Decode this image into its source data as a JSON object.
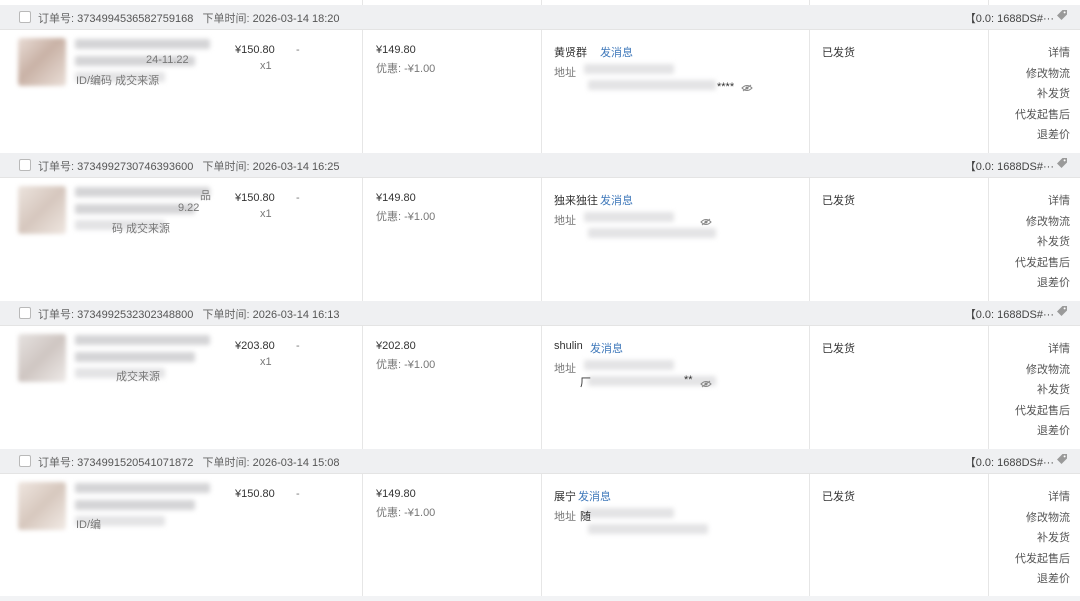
{
  "labels": {
    "order_no": "订单号:",
    "order_time": "下单时间:",
    "send_msg": "发消息",
    "address": "地址",
    "discount": "优惠: -¥1.00",
    "qty": "x1",
    "dash": "-",
    "id_code": "ID/编码",
    "source": "成交来源",
    "source_partial": "码 成交来源"
  },
  "actions": [
    "详情",
    "修改物流",
    "补发货",
    "代发起售后",
    "退差价"
  ],
  "orders": [
    {
      "order_no": "3734994536582759168",
      "order_time": "2026-03-14 18:20",
      "tag": "【0.0: 1688DS#···",
      "unit_price": "¥150.80",
      "qty": "x1",
      "paid": "¥149.80",
      "discount": "优惠: -¥1.00",
      "buyer": "黄贤群",
      "address_tail": "****",
      "status": "已发货",
      "meta_line": "ID/编码  成交来源",
      "date_fragment": "24-11.22"
    },
    {
      "order_no": "3734992730746393600",
      "order_time": "2026-03-14 16:25",
      "tag": "【0.0: 1688DS#···",
      "unit_price": "¥150.80",
      "qty": "x1",
      "paid": "¥149.80",
      "discount": "优惠: -¥1.00",
      "buyer": "独来独往",
      "address_tail": "",
      "status": "已发货",
      "meta_line": "码  成交来源",
      "date_fragment": "9.22",
      "title_fragment": "品"
    },
    {
      "order_no": "3734992532302348800",
      "order_time": "2026-03-14 16:13",
      "tag": "【0.0: 1688DS#···",
      "unit_price": "¥203.80",
      "qty": "x1",
      "paid": "¥202.80",
      "discount": "优惠: -¥1.00",
      "buyer": "shulin",
      "address_tail": "**",
      "status": "已发货",
      "meta_line": "成交来源",
      "address_prefix": "厂"
    },
    {
      "order_no": "3734991520541071872",
      "order_time": "2026-03-14 15:08",
      "tag": "【0.0: 1688DS#···",
      "unit_price": "¥150.80",
      "qty": "",
      "paid": "¥149.80",
      "discount": "优惠: -¥1.00",
      "buyer": "展宁",
      "address_tail": "",
      "status": "已发货",
      "meta_line": "ID/编",
      "address_prefix": "随"
    }
  ],
  "colors": {
    "link": "#3f78ba",
    "header_bg": "#eff0f2",
    "body_bg": "#ffffff"
  }
}
